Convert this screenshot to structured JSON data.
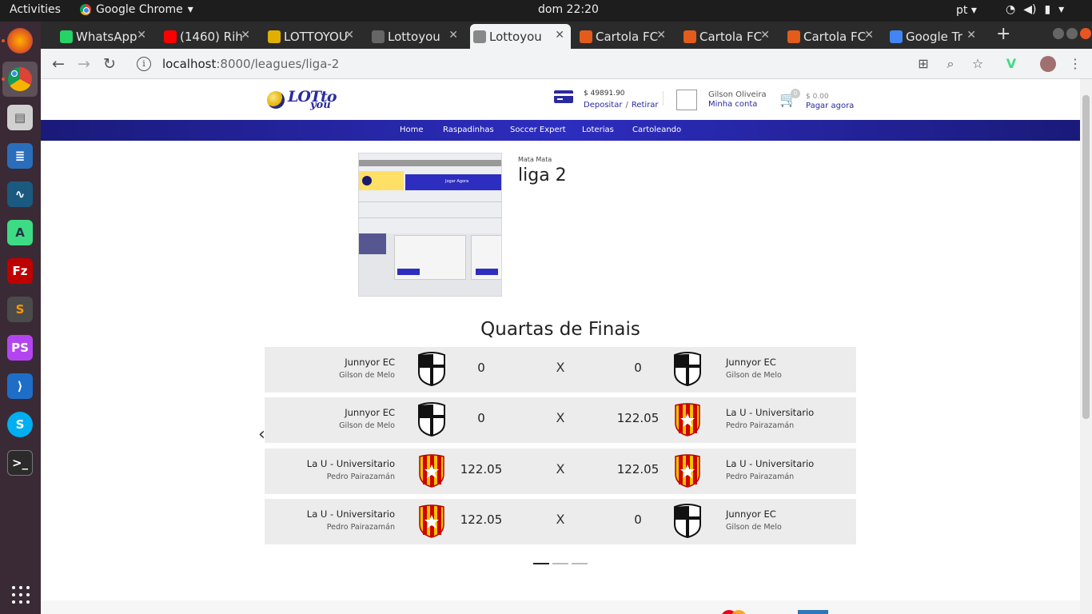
{
  "os": {
    "activities": "Activities",
    "app_menu": "Google Chrome",
    "clock": "dom 22:20",
    "language": "pt",
    "dock_items": [
      "firefox",
      "chrome",
      "files",
      "libreoffice-writer",
      "mysql-workbench",
      "android-studio",
      "filezilla",
      "sublime-text",
      "phpstorm",
      "vscode",
      "skype",
      "terminal"
    ]
  },
  "tabs": [
    {
      "label": "WhatsApp",
      "favicon_color": "#25d366"
    },
    {
      "label": "(1460) Rih",
      "favicon_color": "#ff0000"
    },
    {
      "label": "LOTTOYOU",
      "favicon_color": "#e0b000"
    },
    {
      "label": "Lottoyou",
      "favicon_color": "#666666"
    },
    {
      "label": "Lottoyou",
      "favicon_color": "#888888"
    },
    {
      "label": "Cartola FC",
      "favicon_color": "#e25c1c"
    },
    {
      "label": "Cartola FC",
      "favicon_color": "#e25c1c"
    },
    {
      "label": "Cartola FC",
      "favicon_color": "#e25c1c"
    },
    {
      "label": "Google Tr",
      "favicon_color": "#4285f4"
    }
  ],
  "url": {
    "host": "localhost",
    "path": ":8000/leagues/liga-2"
  },
  "header": {
    "balance": "$ 49891.90",
    "deposit": "Depositar",
    "withdraw": "Retirar",
    "user_name": "Gilson Oliveira",
    "my_account": "Minha conta",
    "cart_count": "0",
    "cart_total": "$ 0.00",
    "pay_now": "Pagar agora"
  },
  "nav": [
    "Home",
    "Raspadinhas",
    "Soccer Expert",
    "Loterias",
    "Cartoleando"
  ],
  "league": {
    "type": "Mata Mata",
    "name": "liga 2",
    "thumb_button": "Jogar Agora"
  },
  "bracket": {
    "round_title": "Quartas de Finais",
    "vs": "X",
    "matches": [
      {
        "home": {
          "name": "Junnyor EC",
          "owner": "Gilson de Melo",
          "score": "0",
          "crest": "junnyor"
        },
        "away": {
          "name": "Junnyor EC",
          "owner": "Gilson de Melo",
          "score": "0",
          "crest": "junnyor"
        }
      },
      {
        "home": {
          "name": "Junnyor EC",
          "owner": "Gilson de Melo",
          "score": "0",
          "crest": "junnyor"
        },
        "away": {
          "name": "La U - Universitario",
          "owner": "Pedro Pairazamán",
          "score": "122.05",
          "crest": "universitario"
        }
      },
      {
        "home": {
          "name": "La U - Universitario",
          "owner": "Pedro Pairazamán",
          "score": "122.05",
          "crest": "universitario"
        },
        "away": {
          "name": "La U - Universitario",
          "owner": "Pedro Pairazamán",
          "score": "122.05",
          "crest": "universitario"
        }
      },
      {
        "home": {
          "name": "La U - Universitario",
          "owner": "Pedro Pairazamán",
          "score": "122.05",
          "crest": "universitario"
        },
        "away": {
          "name": "Junnyor EC",
          "owner": "Gilson de Melo",
          "score": "0",
          "crest": "junnyor"
        }
      }
    ],
    "slides": 3,
    "active_slide": 0
  },
  "colors": {
    "brand": "#2a2aa0",
    "nav_bg": "#2d2dc0",
    "row_bg": "#ececec"
  }
}
